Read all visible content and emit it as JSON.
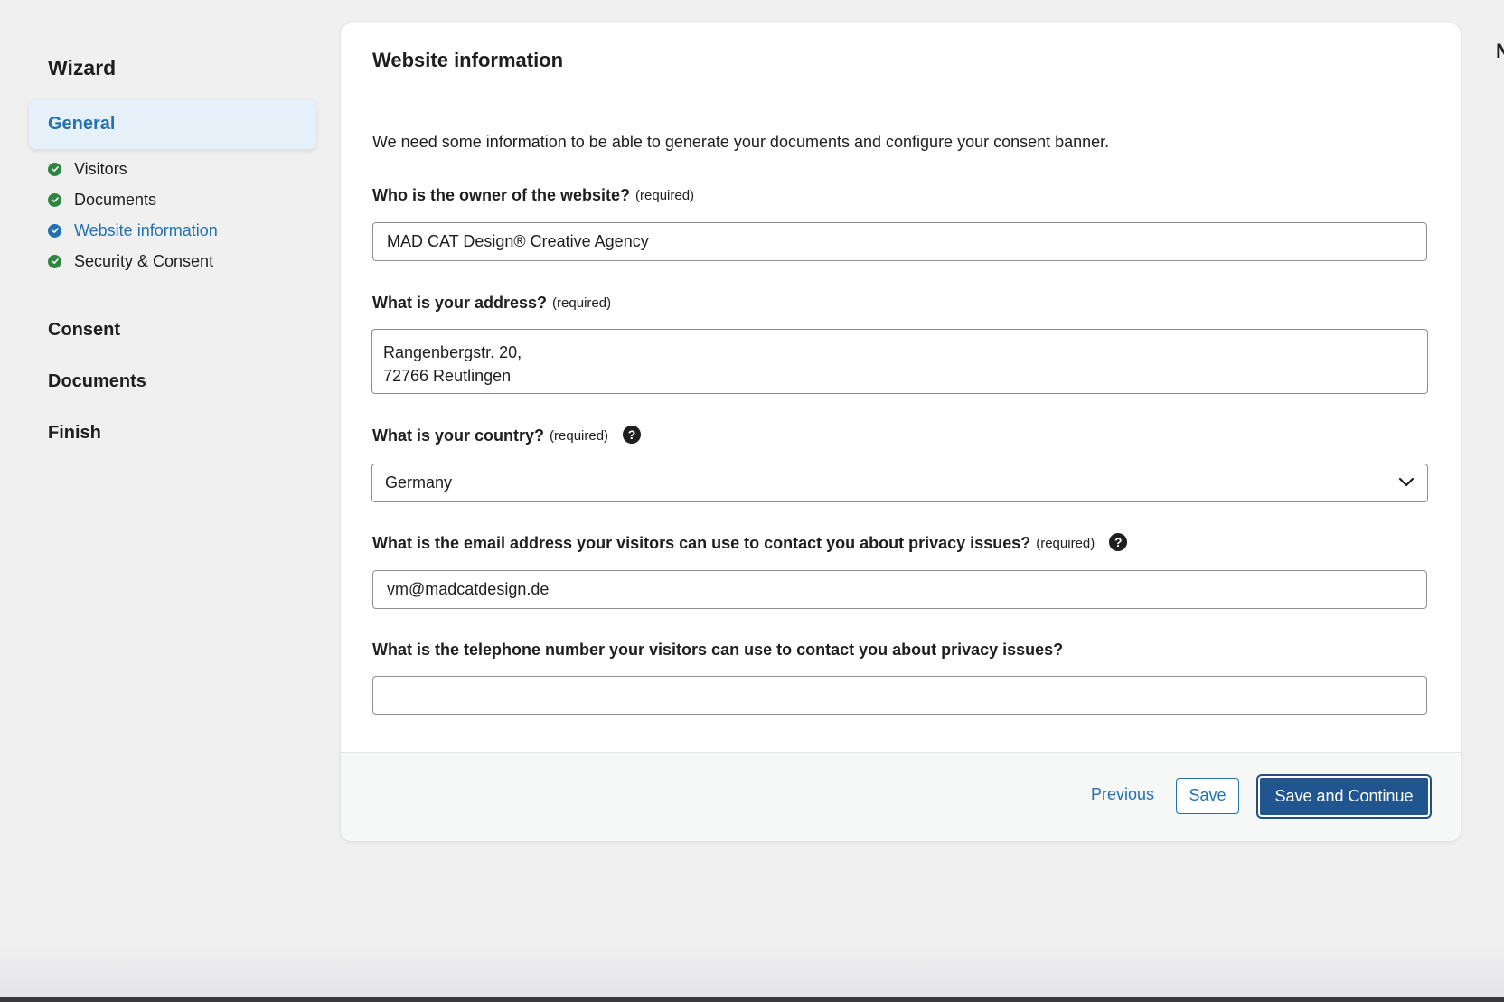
{
  "sidebar": {
    "title": "Wizard",
    "active_section": "General",
    "substeps": [
      {
        "label": "Visitors",
        "status": "done",
        "color": "#2e8540"
      },
      {
        "label": "Documents",
        "status": "done",
        "color": "#2e8540"
      },
      {
        "label": "Website information",
        "status": "current",
        "color": "#2271b1"
      },
      {
        "label": "Security & Consent",
        "status": "done",
        "color": "#2e8540"
      }
    ],
    "sections": [
      "Consent",
      "Documents",
      "Finish"
    ]
  },
  "main": {
    "title": "Website information",
    "intro": "We need some information to be able to generate your documents and configure your consent banner.",
    "owner": {
      "question": "Who is the owner of the website?",
      "required": "(required)",
      "value": "MAD CAT Design® Creative Agency"
    },
    "address": {
      "question": "What is your address?",
      "required": "(required)",
      "line1": "Rangenbergstr. 20,",
      "line2": "72766 Reutlingen"
    },
    "country": {
      "question": "What is your country?",
      "required": "(required)",
      "value": "Germany",
      "help_icon": "question-circle-icon"
    },
    "email": {
      "question": "What is the email address your visitors can use to contact you about privacy issues?",
      "required": "(required)",
      "value": "vm@madcatdesign.de",
      "help_icon": "question-circle-icon"
    },
    "phone": {
      "question": "What is the telephone number your visitors can use to contact you about privacy issues?",
      "value": ""
    }
  },
  "footer": {
    "previous_label": "Previous",
    "save_label": "Save",
    "continue_label": "Save and Continue"
  },
  "corner_glyph": "N",
  "colors": {
    "accent": "#2271b1",
    "done": "#2e8540",
    "background": "#f0f0f1"
  }
}
